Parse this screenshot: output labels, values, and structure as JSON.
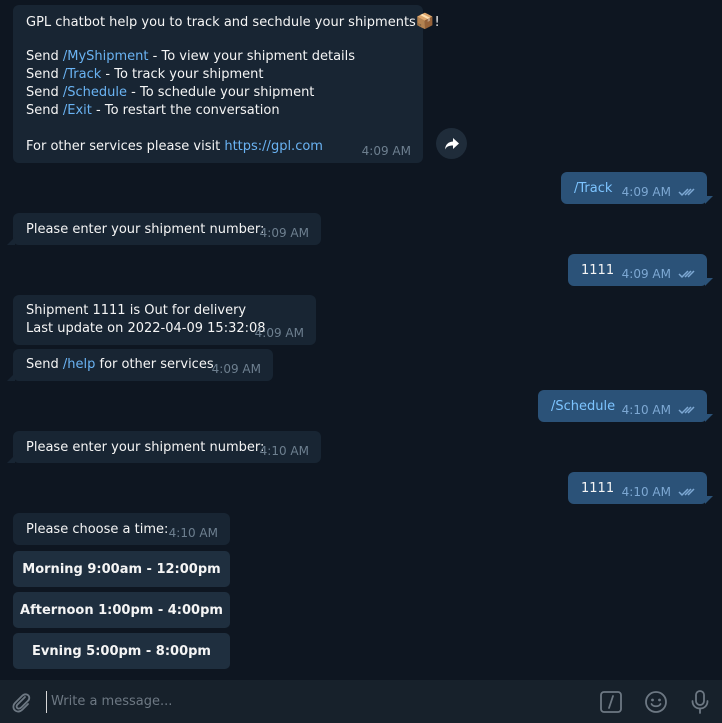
{
  "bot_intro": {
    "title": "GPL chatbot help you to track and sechdule your shipments",
    "title_emoji": "📦",
    "title_suffix": "!",
    "commands": [
      {
        "prefix": "Send ",
        "cmd": "/MyShipment",
        "desc": " - To view your shipment details"
      },
      {
        "prefix": "Send ",
        "cmd": "/Track",
        "desc": " - To track your shipment"
      },
      {
        "prefix": "Send ",
        "cmd": "/Schedule",
        "desc": " - To schedule your shipment"
      },
      {
        "prefix": "Send ",
        "cmd": "/Exit",
        "desc": " - To restart the conversation"
      }
    ],
    "footer_text": "For other services please visit ",
    "footer_link": "https://gpl.com",
    "time": "4:09 AM"
  },
  "messages": {
    "out_track": {
      "text": "/Track",
      "time": "4:09 AM"
    },
    "in_enter1": {
      "text": "Please enter your shipment number:",
      "time": "4:09 AM"
    },
    "out_num1": {
      "text": "1111",
      "time": "4:09 AM"
    },
    "in_status": {
      "line1": "Shipment 1111 is Out for delivery",
      "line2": "Last update on 2022-04-09 15:32:08",
      "time": "4:09 AM"
    },
    "in_help": {
      "prefix": "Send ",
      "cmd": "/help",
      "suffix": " for other services",
      "time": "4:09 AM"
    },
    "out_schedule": {
      "text": "/Schedule",
      "time": "4:10 AM"
    },
    "in_enter2": {
      "text": "Please enter your shipment number:",
      "time": "4:10 AM"
    },
    "out_num2": {
      "text": "1111",
      "time": "4:10 AM"
    },
    "in_choose": {
      "text": "Please choose a time:",
      "time": "4:10 AM"
    }
  },
  "keyboard": [
    "Morning 9:00am - 12:00pm",
    "Afternoon 1:00pm - 4:00pm",
    "Evning 5:00pm - 8:00pm"
  ],
  "composer": {
    "placeholder": "Write a message...",
    "icons": [
      "attach-icon",
      "bot-commands-icon",
      "emoji-icon",
      "microphone-icon"
    ]
  },
  "colors": {
    "background": "#0e1621",
    "incoming_bubble": "#182533",
    "outgoing_bubble": "#2b5278",
    "link": "#6ab3f3",
    "composer": "#17212b"
  }
}
